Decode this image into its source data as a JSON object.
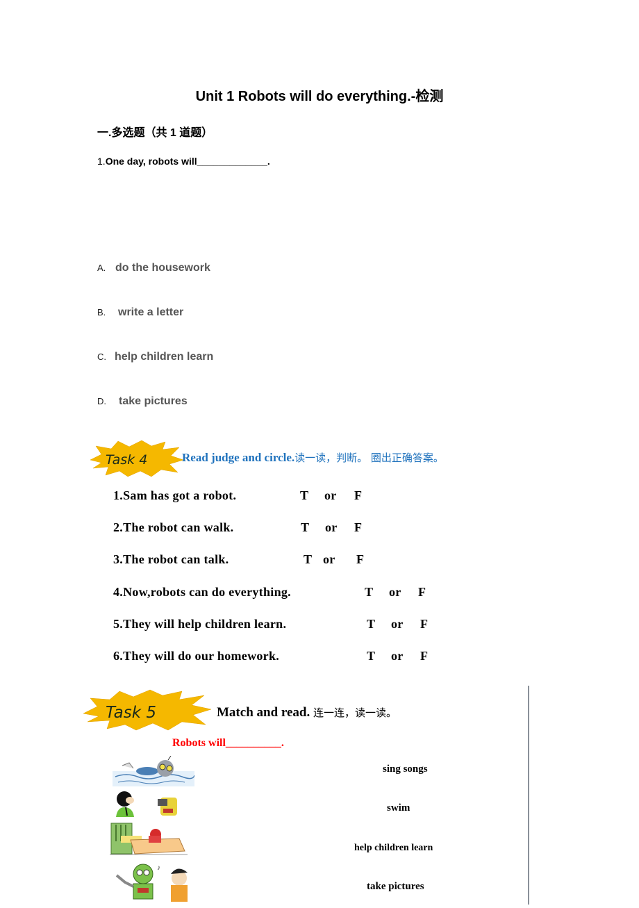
{
  "document": {
    "title": "Unit 1 Robots will do everything.-检测",
    "section_heading": "一.多选题（共 1 道题）",
    "question": {
      "number": "1.",
      "text": "One  day, robots will_____________."
    },
    "options": [
      {
        "letter": "A.",
        "text": "do the housework"
      },
      {
        "letter": "B.",
        "text": "write a letter"
      },
      {
        "letter": "C.",
        "text": "help children learn"
      },
      {
        "letter": "D.",
        "text": "take pictures"
      }
    ]
  },
  "task4": {
    "badge": "Task 4",
    "heading_en": "Read  judge and circle.",
    "heading_cn": "读一读，判断。 圈出正确答案。",
    "items": [
      {
        "text": "1.Sam has got a robot.",
        "t": "T",
        "or": "or",
        "f": "F"
      },
      {
        "text": "2.The robot can walk.",
        "t": "T",
        "or": "or",
        "f": "F"
      },
      {
        "text": "3.The robot can talk.",
        "t": "T",
        "or": "or",
        "f": "F"
      },
      {
        "text": "4.Now,robots can do everything.",
        "t": "T",
        "or": "or",
        "f": "F"
      },
      {
        "text": "5.They will help children learn.",
        "t": "T",
        "or": "or",
        "f": "F"
      },
      {
        "text": "6.They will do our homework.",
        "t": "T",
        "or": "or",
        "f": "F"
      }
    ]
  },
  "task5": {
    "badge": "Task 5",
    "heading_en": "Match and read.",
    "heading_cn": "连一连，读一读。",
    "prompt": "Robots will__________.",
    "pictures": [
      {
        "description": "robot swimming"
      },
      {
        "description": "boy and robot taking pictures"
      },
      {
        "description": "robot making bed"
      },
      {
        "description": "robot and boy singing"
      }
    ],
    "phrases": [
      "sing songs",
      "swim",
      "help children learn",
      "take pictures"
    ]
  },
  "colors": {
    "task4_heading": "#1f72bd",
    "prompt_red": "#ff0000",
    "badge_yellow": "#f5b800",
    "option_gray": "#555555"
  }
}
